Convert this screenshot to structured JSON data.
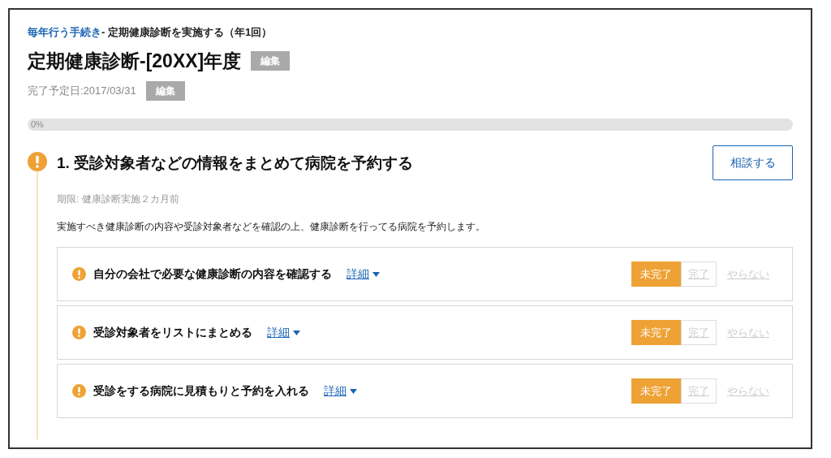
{
  "breadcrumb": {
    "link": "毎年行う手続き",
    "rest": "- 定期健康診断を実施する（年1回）"
  },
  "title": "定期健康診断-[20XX]年度",
  "title_edit": "編集",
  "due": "完了予定日:2017/03/31",
  "due_edit": "編集",
  "progress": {
    "level": 0,
    "label": "0%"
  },
  "section": {
    "title": "1. 受診対象者などの情報をまとめて病院を予約する",
    "consult": "相談する",
    "deadline": "期限: 健康診断実施２カ月前",
    "description": "実施すべき健康診断の内容や受診対象者などを確認の上、健康診断を行ってる病院を予約します。",
    "tasks": [
      {
        "title": "自分の会社で必要な健康診断の内容を確認する",
        "details": "詳細",
        "statuses": [
          {
            "label": "未完了",
            "selected": true
          },
          {
            "label": "完了",
            "selected": false
          }
        ],
        "skip": "やらない"
      },
      {
        "title": "受診対象者をリストにまとめる",
        "details": "詳細",
        "statuses": [
          {
            "label": "未完了",
            "selected": true
          },
          {
            "label": "完了",
            "selected": false
          }
        ],
        "skip": "やらない"
      },
      {
        "title": "受診をする病院に見積もりと予約を入れる",
        "details": "詳細",
        "statuses": [
          {
            "label": "未完了",
            "selected": true
          },
          {
            "label": "完了",
            "selected": false
          }
        ],
        "skip": "やらない"
      }
    ]
  }
}
